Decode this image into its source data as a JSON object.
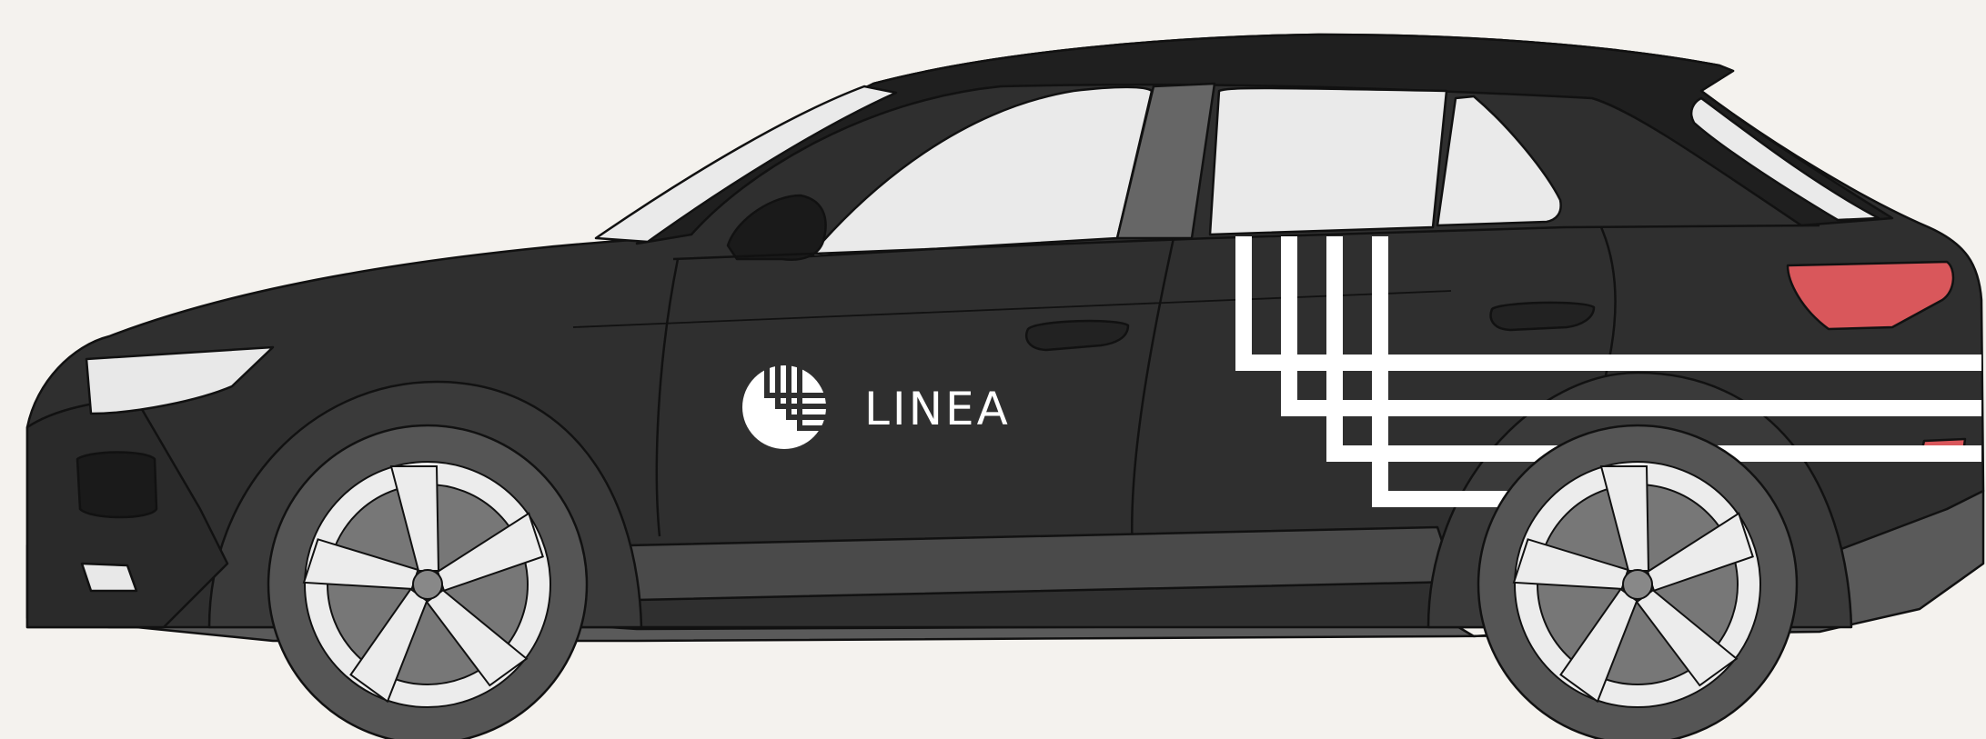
{
  "scene": {
    "subject": "compact-suv-side-view",
    "colors": {
      "background": "#f4f2ee",
      "body": "#2f2f2f",
      "roof": "#1f1f1f",
      "lower_trim": "#5a5a5a",
      "window": "#eaeaea",
      "tire": "#555555",
      "rim": "#ececec",
      "livery": "#ffffff",
      "taillight": "#d9575b",
      "outline": "#111111"
    }
  },
  "livery": {
    "brand_name": "LINEA",
    "logo_icon": "linea-mark-icon"
  }
}
